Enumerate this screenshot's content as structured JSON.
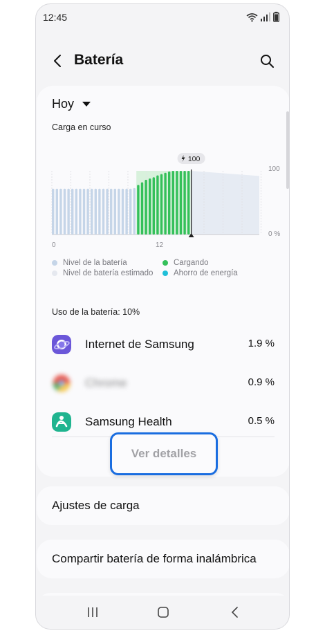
{
  "status": {
    "time": "12:45",
    "icons": [
      "wifi-icon",
      "signal-icon",
      "battery-icon"
    ]
  },
  "header": {
    "title": "Batería",
    "back_icon": "back-arrow-icon",
    "search_icon": "search-icon"
  },
  "summary": {
    "period_label": "Hoy",
    "subtitle": "Carga en curso",
    "chart_data": {
      "type": "bar",
      "x_ticks": [
        "0",
        "12"
      ],
      "y_ticks": [
        "100",
        "0 %"
      ],
      "ylim": [
        0,
        100
      ],
      "current_marker": "100",
      "actual_battery_levels": [
        72,
        72,
        72,
        72,
        72,
        72,
        72,
        72,
        72,
        72,
        72,
        72,
        72,
        72,
        72,
        72,
        72,
        72,
        72,
        72,
        72,
        73
      ],
      "charging_levels": [
        78,
        82,
        86,
        88,
        90,
        93,
        95,
        97,
        99,
        100,
        100,
        100,
        100,
        100
      ],
      "estimated_levels_range": [
        100,
        92
      ],
      "colors": {
        "battery_level": "#c5d5e8",
        "charging": "#34c05a",
        "estimated": "#e6ebf3",
        "power_saving": "#1fbfd8"
      }
    },
    "legend": [
      {
        "label": "Nivel de la batería",
        "color": "#c5d5e8"
      },
      {
        "label": "Cargando",
        "color": "#34c05a"
      },
      {
        "label": "Nivel de batería estimado",
        "color": "#e5e8ef"
      },
      {
        "label": "Ahorro de energía",
        "color": "#1fbfd8"
      }
    ],
    "usage_title": "Uso de la batería: 10%",
    "apps": [
      {
        "name": "Internet de Samsung",
        "percent": "1.9 %",
        "icon": "samsung-internet-icon"
      },
      {
        "name": "Chrome",
        "percent": "0.9 %",
        "icon": "chrome-icon"
      },
      {
        "name": "Samsung Health",
        "percent": "0.5 %",
        "icon": "samsung-health-icon"
      }
    ],
    "details_button": "Ver detalles"
  },
  "settings": [
    {
      "label": "Ajustes de carga"
    },
    {
      "label": "Compartir batería de forma inalámbrica"
    }
  ],
  "navbar": {
    "icons": [
      "recents-icon",
      "home-icon",
      "back-icon"
    ]
  }
}
